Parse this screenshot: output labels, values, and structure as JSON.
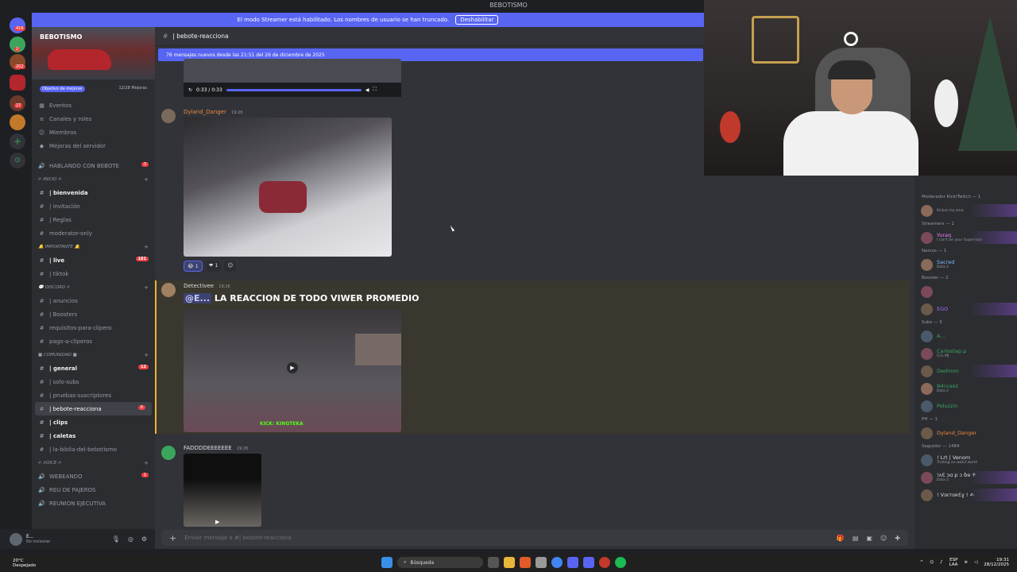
{
  "window": {
    "title": "BEBOTISMO"
  },
  "streamer_banner": {
    "text": "El modo Streamer está habilitado. Los nombres de usuario se han truncado.",
    "button": "Deshabilitar"
  },
  "rail": {
    "badges": [
      "416",
      "2",
      "202",
      "27"
    ]
  },
  "server": {
    "name": "BEBOTISMO",
    "boost_label": "Objetivo de mejoras",
    "boost_count": "12/28 Mejoras"
  },
  "menu": [
    "Eventos",
    "Canales y roles",
    "Miembros",
    "Mejoras del servidor"
  ],
  "channels": [
    {
      "kind": "voice",
      "name": "HABLANDO CON BEBOTE",
      "count": "3"
    },
    {
      "kind": "cat",
      "name": "✍ INICIO ✍"
    },
    {
      "kind": "text",
      "name": "| bienvenida",
      "bold": true
    },
    {
      "kind": "text",
      "name": "| invitación"
    },
    {
      "kind": "text",
      "name": "| Reglas"
    },
    {
      "kind": "text",
      "name": "moderator-only"
    },
    {
      "kind": "cat",
      "name": "🔔 IMPORTANTE 🔔"
    },
    {
      "kind": "text",
      "name": "| live",
      "bold": true,
      "count": "181"
    },
    {
      "kind": "text",
      "name": "| tiktok"
    },
    {
      "kind": "cat",
      "name": "💬 DISCORD ✍"
    },
    {
      "kind": "text",
      "name": "| anuncios"
    },
    {
      "kind": "text",
      "name": "| Boosters"
    },
    {
      "kind": "text",
      "name": "requisitos-para-clipero"
    },
    {
      "kind": "text",
      "name": "pago-a-cliperos"
    },
    {
      "kind": "cat",
      "name": "■ COMUNIDAD ■"
    },
    {
      "kind": "text",
      "name": "| general",
      "bold": true,
      "count": "12"
    },
    {
      "kind": "text",
      "name": "| solo-subs"
    },
    {
      "kind": "text",
      "name": "| pruebas-suscriptores"
    },
    {
      "kind": "text",
      "name": "| bebote-reacciona",
      "active": true,
      "count": "6"
    },
    {
      "kind": "text",
      "name": "| clips",
      "bold": true
    },
    {
      "kind": "text",
      "name": "| caletas",
      "bold": true
    },
    {
      "kind": "text",
      "name": "| la-biblia-del-bebotismo"
    },
    {
      "kind": "cat",
      "name": "✍ VOICE ✍"
    },
    {
      "kind": "voice",
      "name": "WEBEANDO",
      "count": "1"
    },
    {
      "kind": "voice",
      "name": "REU DE PAJEROS"
    },
    {
      "kind": "voice",
      "name": "REUNION EJECUTIVA"
    }
  ],
  "user": {
    "name": "E...",
    "status": "No molestar"
  },
  "chat": {
    "channel": "| bebote-reacciona",
    "new_messages": "76 mensajes nuevos desde las 21:51 del 26 de diciembre de 2025",
    "player_time": "0:33 / 0:33",
    "messages": [
      {
        "author": "Dyland_Danger",
        "color": "#f0883e",
        "time": "19:26",
        "reactions": [
          "1",
          "1"
        ]
      },
      {
        "author": "Detectivee",
        "color": "#dbdee1",
        "time": "19:26",
        "mention": "@E...",
        "text": "LA REACCION DE TODO VIWER PROMEDIO",
        "overlay": "KICK: KINGTEKA"
      },
      {
        "author": "FADDDDEEEEEEE",
        "color": "#dbdee1",
        "time": "19:26"
      }
    ],
    "composer_placeholder": "Enviar mensaje a #| bebote-reacciona"
  },
  "members": [
    {
      "group": "Moderador Kick/Twitch — 1"
    },
    {
      "name": "",
      "sub": "Kickut ma ama",
      "color": "#5865f2",
      "glow": true
    },
    {
      "group": "Streamers — 1"
    },
    {
      "name": "Yuraq",
      "sub": "I can't be your Superman",
      "color": "#f47fff",
      "glow": true
    },
    {
      "group": "Narcos — 1"
    },
    {
      "name": "Sacred",
      "sub": "Dota 2",
      "color": "#7fb5ff"
    },
    {
      "group": "Booster — 2"
    },
    {
      "name": "",
      "sub": "",
      "color": "#a970ff"
    },
    {
      "name": "EGO",
      "sub": "",
      "color": "#a970ff",
      "glow": true
    },
    {
      "group": "Subs — 5"
    },
    {
      "name": "A...",
      "sub": "",
      "color": "#3ba55c"
    },
    {
      "name": "Carlostap.p",
      "sub": "Cris MJ",
      "color": "#3ba55c"
    },
    {
      "name": "Dedmon",
      "sub": "",
      "color": "#3ba55c",
      "glow": true
    },
    {
      "name": "N4rvaez",
      "sub": "Dota 2",
      "color": "#3ba55c"
    },
    {
      "name": "Peluzzin",
      "sub": "",
      "color": "#3ba55c"
    },
    {
      "group": "PH — 1"
    },
    {
      "name": "Dyland_Danger",
      "sub": "",
      "color": "#f0883e"
    },
    {
      "group": "Seguidor — 1484"
    },
    {
      "name": "! Lrt | Venom",
      "sub": "Trading on web3.world",
      "color": "#dbdee1"
    },
    {
      "name": "!ʌƐ ɔɑ p ɔ ɓɘ ♱",
      "sub": "Dota 2",
      "color": "#dbdee1",
      "glow": true
    },
    {
      "name": "! VɪᴋᴛᴏʀƐɣ ! ✍",
      "sub": "",
      "color": "#dbdee1",
      "glow": true
    }
  ],
  "taskbar": {
    "temp": "20°C",
    "weather": "Despejado",
    "search": "Búsqueda",
    "lang": "ESP",
    "lang2": "LAA",
    "time": "19:31",
    "date": "28/12/2025"
  }
}
